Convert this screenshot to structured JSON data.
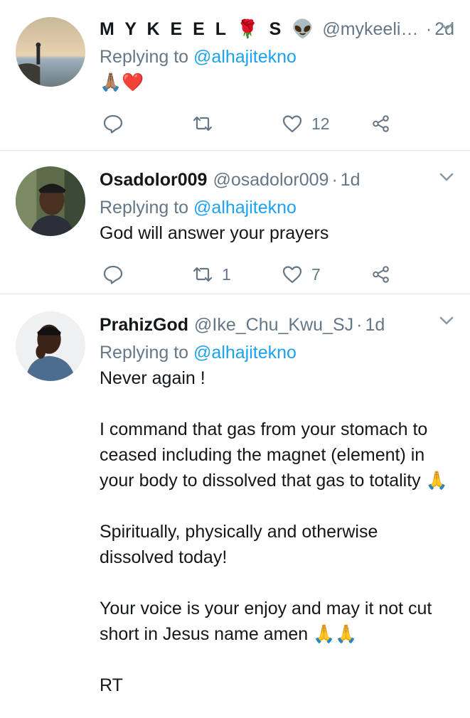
{
  "tweets": [
    {
      "name": "M Y K E E L 🌹 S 👽",
      "handle": "@mykeelis...",
      "separator": "·",
      "time": "2d",
      "replying_prefix": "Replying to",
      "replying_to": "@alhajitekno",
      "text": "🙏🏽❤️",
      "retweets": "",
      "likes": "12",
      "avatar_icon": "avatar-photo"
    },
    {
      "name": "Osadolor009",
      "handle": "@osadolor009",
      "separator": "·",
      "time": "1d",
      "replying_prefix": "Replying to",
      "replying_to": "@alhajitekno",
      "text": "God will answer your prayers",
      "retweets": "1",
      "likes": "7",
      "avatar_icon": "avatar-photo"
    },
    {
      "name": "PrahizGod",
      "handle": "@Ike_Chu_Kwu_SJ",
      "separator": "·",
      "time": "1d",
      "replying_prefix": "Replying to",
      "replying_to": "@alhajitekno",
      "text": "Never again !\n\nI command that gas from your stomach to ceased including the magnet (element) in your body to dissolved that gas to totality 🙏\n\nSpiritually, physically and otherwise dissolved today!\n\nYour voice is your enjoy and may it not cut short in Jesus name amen 🙏🙏\n\nRT",
      "avatar_icon": "avatar-photo"
    }
  ],
  "colors": {
    "link": "#1da1f2",
    "secondary": "#657786",
    "divider": "#e1e8ed",
    "primary_text": "#14171a"
  }
}
